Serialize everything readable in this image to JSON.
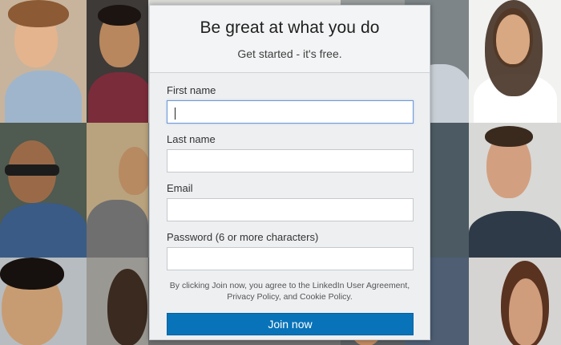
{
  "signup": {
    "headline": "Be great at what you do",
    "subhead": "Get started - it's free.",
    "fields": [
      {
        "label": "First name",
        "value": ""
      },
      {
        "label": "Last name",
        "value": ""
      },
      {
        "label": "Email",
        "value": ""
      },
      {
        "label": "Password (6 or more characters)",
        "value": ""
      }
    ],
    "legal_text": "By clicking Join now, you agree to the LinkedIn User Agreement, Privacy Policy, and Cookie Policy.",
    "join_label": "Join now"
  },
  "colors": {
    "button": "#0873b9",
    "focus_border": "#6f9ad6",
    "card_bg": "#edeff1"
  }
}
